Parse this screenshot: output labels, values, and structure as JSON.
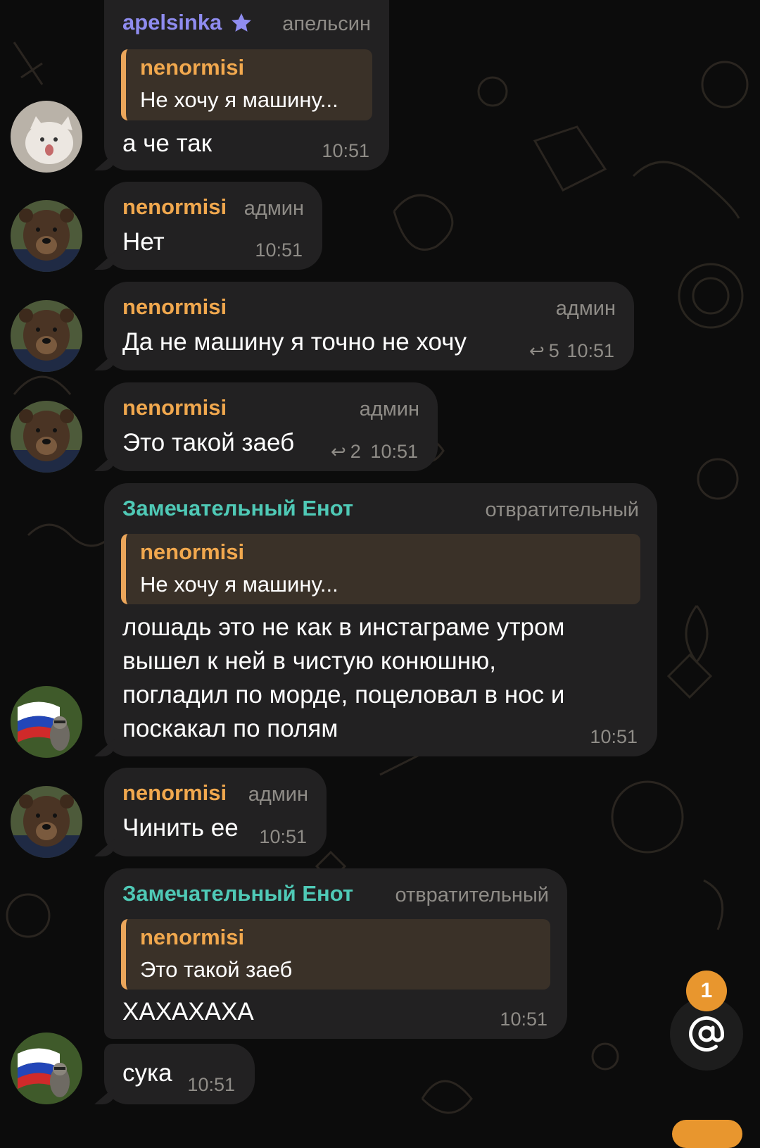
{
  "colors": {
    "background": "#0c0c0c",
    "bubble": "#222122",
    "accent_orange": "#f1a84e",
    "name_purple": "#8f8cf0",
    "name_teal": "#4fc9b6",
    "muted": "#8f8c87",
    "quote_bg": "#3a3128"
  },
  "messages": [
    {
      "sender": "apelsinka",
      "role": "апельсин",
      "reply_to": {
        "name": "nenormisi",
        "text": "Не хочу я машину..."
      },
      "text": "а че так",
      "time": "10:51"
    },
    {
      "sender": "nenormisi",
      "role": "админ",
      "text": "Нет",
      "time": "10:51"
    },
    {
      "sender": "nenormisi",
      "role": "админ",
      "text": "Да не машину я точно не хочу",
      "replies": "5",
      "time": "10:51"
    },
    {
      "sender": "nenormisi",
      "role": "админ",
      "text": "Это такой заеб",
      "replies": "2",
      "time": "10:51"
    },
    {
      "sender": "Замечательный Енот",
      "role": "отвратительный",
      "reply_to": {
        "name": "nenormisi",
        "text": "Не хочу я машину..."
      },
      "lines": [
        "лошадь это не как в инстаграме утром",
        "вышел к ней в чистую конюшню,",
        "погладил по морде, поцеловал в нос и",
        "поскакал по полям"
      ],
      "time": "10:51"
    },
    {
      "sender": "nenormisi",
      "role": "админ",
      "text": "Чинить ее",
      "time": "10:51"
    },
    {
      "sender": "Замечательный Енот",
      "role": "отвратительный",
      "reply_to": {
        "name": "nenormisi",
        "text": "Это такой заеб"
      },
      "text": "ХАХАХАХА",
      "time": "10:51"
    },
    {
      "text": "сука",
      "time": "10:51"
    }
  ],
  "mentions": {
    "count": "1",
    "icon": "at-icon"
  }
}
